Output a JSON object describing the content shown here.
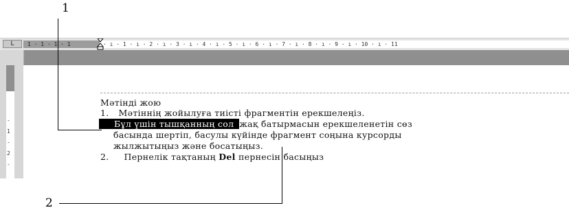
{
  "callouts": {
    "one": "1",
    "two": "2"
  },
  "ruler": {
    "tab_selector": "L",
    "left_ticks": "1 · 1 · 1 · 1",
    "ticks": "· ı · 1 · ı · 2 · ı · 3 · ı · 4 · ı · 5 · ı · 6 · ı · 7 · ı · 8 · ı · 9 · ı · 10 · ı · 11"
  },
  "vruler_ticks": [
    "-",
    "1",
    "-",
    "2",
    "-"
  ],
  "document": {
    "heading": "Мәтінді жою",
    "item1_num": "1.",
    "item1_text": "Мәтіннің  жойылуға тиісті фрагментін ерекшелеңіз.",
    "line2_selected": "Бұл үшін тышқанның сол",
    "line2_rest": "жақ батырмасын ерекшеленетін сөз",
    "line3": "басында шертіп, басулы күйінде фрагмент соңына  курсорды",
    "line4": "жылжытыңыз және босатыңыз.",
    "item2_num": "2.",
    "item2_before": "Пернелік тақтаның ",
    "item2_key": "Del",
    "item2_after": " пернесін басыңыз"
  }
}
